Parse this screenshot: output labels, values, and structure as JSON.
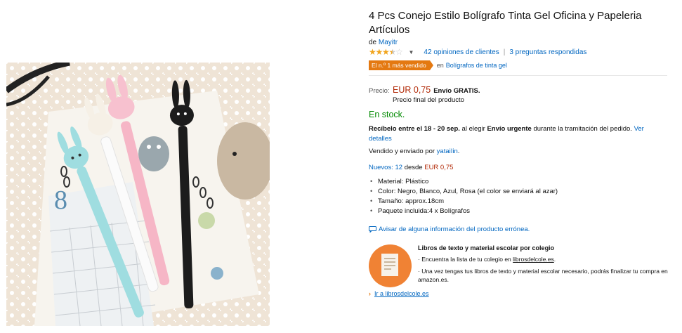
{
  "product": {
    "title": "4 Pcs Conejo Estilo Bolígrafo Tinta Gel Oficina y Papeleria Artículos",
    "by_prefix": "de",
    "brand": "Mayitr",
    "rating": 3.5,
    "reviews_link": "42 opiniones de clientes",
    "questions_link": "3 preguntas respondidas",
    "badge_label": "El n.º 1 más vendido",
    "badge_in": "en",
    "badge_category": "Bolígrafos de tinta gel",
    "price_label": "Precio:",
    "price": "EUR 0,75",
    "shipping": "Envío GRATIS.",
    "final_price": "Precio final del producto",
    "stock": "En stock.",
    "delivery_bold": "Recíbelo entre el 18 - 20 sep.",
    "delivery_mid": "al elegir",
    "delivery_bold2": "Envío urgente",
    "delivery_rest": "durante la tramitación del pedido.",
    "delivery_link": "Ver detalles",
    "seller_prefix": "Vendido y enviado por",
    "seller_name": "yataiIin",
    "new_label": "Nuevos: 12",
    "new_from": "desde",
    "new_price": "EUR 0,75",
    "features": [
      "Material: Plástico",
      "Color: Negro, Blanco, Azul, Rosa (el color se enviará al azar)",
      "Tamaño: approx.18cm",
      "Paquete incluida:4 x Bolígrafos"
    ],
    "report_link": "Avisar de alguna información del producto errónea."
  },
  "promo": {
    "title": "Libros de texto y material escolar por colegio",
    "line1_prefix": "· Encuentra la lista de tu colegio en",
    "line1_link": "librosdelcole.es",
    "line1_suffix": ".",
    "line2": "· Una vez tengas tus libros de texto y material escolar necesario, podrás finalizar tu compra en amazon.es.",
    "go_link": "Ir a librosdelcole.es"
  },
  "icons": [
    "star-icon",
    "chevron-down-icon",
    "chat-bubble-icon",
    "arrow-right-icon",
    "book-list-icon"
  ],
  "colors": {
    "link": "#0066c0",
    "price": "#b12704",
    "in_stock": "#008a00",
    "badge": "#e47911",
    "star": "#f1a41c",
    "promo_circle": "#f08234"
  }
}
